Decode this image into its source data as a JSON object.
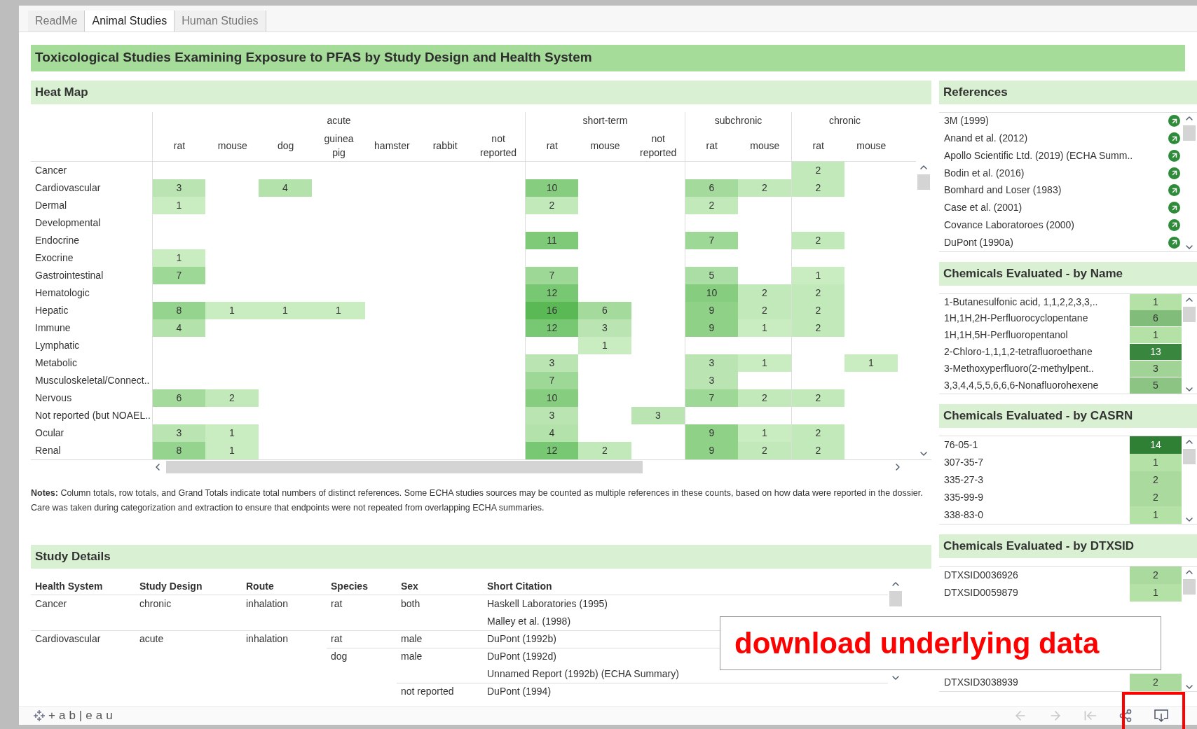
{
  "tabs": [
    {
      "label": "ReadMe",
      "selected": false
    },
    {
      "label": "Animal Studies",
      "selected": true
    },
    {
      "label": "Human Studies",
      "selected": false
    }
  ],
  "title": "Toxicological Studies Examining Exposure to PFAS by Study Design and Health System",
  "heat_map": {
    "title": "Heat Map",
    "groups": [
      {
        "label": "acute",
        "columns": [
          "rat",
          "mouse",
          "dog",
          "guinea pig",
          "hamster",
          "rabbit",
          "not reported"
        ]
      },
      {
        "label": "short-term",
        "columns": [
          "rat",
          "mouse",
          "not reported"
        ]
      },
      {
        "label": "subchronic",
        "columns": [
          "rat",
          "mouse"
        ]
      },
      {
        "label": "chronic",
        "columns": [
          "rat",
          "mouse"
        ]
      }
    ],
    "rows": [
      {
        "label": "Cancer",
        "cells": [
          null,
          null,
          null,
          null,
          null,
          null,
          null,
          null,
          null,
          null,
          null,
          null,
          "2",
          null
        ]
      },
      {
        "label": "Cardiovascular",
        "cells": [
          "3",
          null,
          "4",
          null,
          null,
          null,
          null,
          "10",
          null,
          null,
          "6",
          "2",
          "2",
          null
        ]
      },
      {
        "label": "Dermal",
        "cells": [
          "1",
          null,
          null,
          null,
          null,
          null,
          null,
          "2",
          null,
          null,
          "2",
          null,
          null,
          null
        ]
      },
      {
        "label": "Developmental",
        "cells": [
          null,
          null,
          null,
          null,
          null,
          null,
          null,
          null,
          null,
          null,
          null,
          null,
          null,
          null
        ]
      },
      {
        "label": "Endocrine",
        "cells": [
          null,
          null,
          null,
          null,
          null,
          null,
          null,
          "11",
          null,
          null,
          "7",
          null,
          "2",
          null
        ]
      },
      {
        "label": "Exocrine",
        "cells": [
          "1",
          null,
          null,
          null,
          null,
          null,
          null,
          null,
          null,
          null,
          null,
          null,
          null,
          null
        ]
      },
      {
        "label": "Gastrointestinal",
        "cells": [
          "7",
          null,
          null,
          null,
          null,
          null,
          null,
          "7",
          null,
          null,
          "5",
          null,
          "1",
          null
        ]
      },
      {
        "label": "Hematologic",
        "cells": [
          null,
          null,
          null,
          null,
          null,
          null,
          null,
          "12",
          null,
          null,
          "10",
          "2",
          "2",
          null
        ]
      },
      {
        "label": "Hepatic",
        "cells": [
          "8",
          "1",
          "1",
          "1",
          null,
          null,
          null,
          "16",
          "6",
          null,
          "9",
          "2",
          "2",
          null
        ]
      },
      {
        "label": "Immune",
        "cells": [
          "4",
          null,
          null,
          null,
          null,
          null,
          null,
          "12",
          "3",
          null,
          "9",
          "1",
          "2",
          null
        ]
      },
      {
        "label": "Lymphatic",
        "cells": [
          null,
          null,
          null,
          null,
          null,
          null,
          null,
          null,
          "1",
          null,
          null,
          null,
          null,
          null
        ]
      },
      {
        "label": "Metabolic",
        "cells": [
          null,
          null,
          null,
          null,
          null,
          null,
          null,
          "3",
          null,
          null,
          "3",
          "1",
          null,
          "1"
        ]
      },
      {
        "label": "Musculoskeletal/Connect..",
        "cells": [
          null,
          null,
          null,
          null,
          null,
          null,
          null,
          "7",
          null,
          null,
          "3",
          null,
          null,
          null
        ]
      },
      {
        "label": "Nervous",
        "cells": [
          "6",
          "2",
          null,
          null,
          null,
          null,
          null,
          "10",
          null,
          null,
          "7",
          "2",
          "2",
          null
        ]
      },
      {
        "label": "Not reported (but NOAEL..",
        "cells": [
          null,
          null,
          null,
          null,
          null,
          null,
          null,
          "3",
          null,
          "3",
          null,
          null,
          null,
          null
        ]
      },
      {
        "label": "Ocular",
        "cells": [
          "3",
          "1",
          null,
          null,
          null,
          null,
          null,
          "4",
          null,
          null,
          "9",
          "1",
          "2",
          null
        ]
      },
      {
        "label": "Renal",
        "cells": [
          "8",
          "1",
          null,
          null,
          null,
          null,
          null,
          "12",
          "2",
          null,
          "9",
          "2",
          "2",
          null
        ]
      }
    ]
  },
  "notes": "**Notes:** Column totals, row totals, and Grand Totals indicate total numbers of distinct references. Some ECHA studies sources may be counted as multiple references in these counts, based on how data were reported in the dossier. Care was taken during categorization and extraction to ensure that endpoints were not repeated from overlapping ECHA summaries.",
  "study_details": {
    "title": "Study Details",
    "columns": [
      "Health System",
      "Study Design",
      "Route",
      "Species",
      "Sex",
      "Short Citation"
    ],
    "rows": [
      [
        "Cancer",
        "chronic",
        "inhalation",
        "rat",
        "both",
        "Haskell Laboratories (1995)"
      ],
      [
        null,
        null,
        null,
        null,
        null,
        "Malley et al. (1998)"
      ],
      [
        "Cardiovascular",
        "acute",
        "inhalation",
        "rat",
        "male",
        "DuPont (1992b)"
      ],
      [
        null,
        null,
        null,
        "dog",
        "male",
        "DuPont (1992d)"
      ],
      [
        null,
        null,
        null,
        null,
        null,
        "Unnamed Report (1992b) (ECHA Summary)"
      ],
      [
        null,
        null,
        null,
        null,
        "not reported",
        "DuPont (1994)"
      ]
    ]
  },
  "references": {
    "title": "References",
    "items": [
      "3M (1999)",
      "Anand et al. (2012)",
      "Apollo Scientific Ltd. (2019) (ECHA Summ..",
      "Bodin et al. (2016)",
      "Bomhard and Loser (1983)",
      "Case et al. (2001)",
      "Covance Laboratoroes (2000)",
      "DuPont (1990a)"
    ]
  },
  "chemicals_by_name": {
    "title": "Chemicals Evaluated - by Name",
    "items": [
      {
        "label": "1-Butanesulfonic acid, 1,1,2,2,3,3,..",
        "count": "1"
      },
      {
        "label": "1H,1H,2H-Perfluorocyclopentane",
        "count": "6"
      },
      {
        "label": "1H,1H,5H-Perfluoropentanol",
        "count": "1"
      },
      {
        "label": "2-Chloro-1,1,1,2-tetrafluoroethane",
        "count": "13"
      },
      {
        "label": "3-Methoxyperfluoro(2-methylpent..",
        "count": "3"
      },
      {
        "label": "3,3,4,4,5,5,6,6,6-Nonafluorohexene",
        "count": "5"
      }
    ]
  },
  "chemicals_by_casrn": {
    "title": "Chemicals Evaluated - by CASRN",
    "items": [
      {
        "label": "76-05-1",
        "count": "14"
      },
      {
        "label": "307-35-7",
        "count": "1"
      },
      {
        "label": "335-27-3",
        "count": "2"
      },
      {
        "label": "335-99-9",
        "count": "2"
      },
      {
        "label": "338-83-0",
        "count": "1"
      }
    ]
  },
  "chemicals_by_dtxsid": {
    "title": "Chemicals Evaluated - by DTXSID",
    "items": [
      {
        "label": "DTXSID0036926",
        "count": "2"
      },
      {
        "label": "DTXSID0059879",
        "count": "1"
      },
      {
        "label": "DTXSID3038939",
        "count": "2"
      }
    ]
  },
  "footer": {
    "logo": "+ab|eau"
  },
  "annotation": "download underlying data"
}
